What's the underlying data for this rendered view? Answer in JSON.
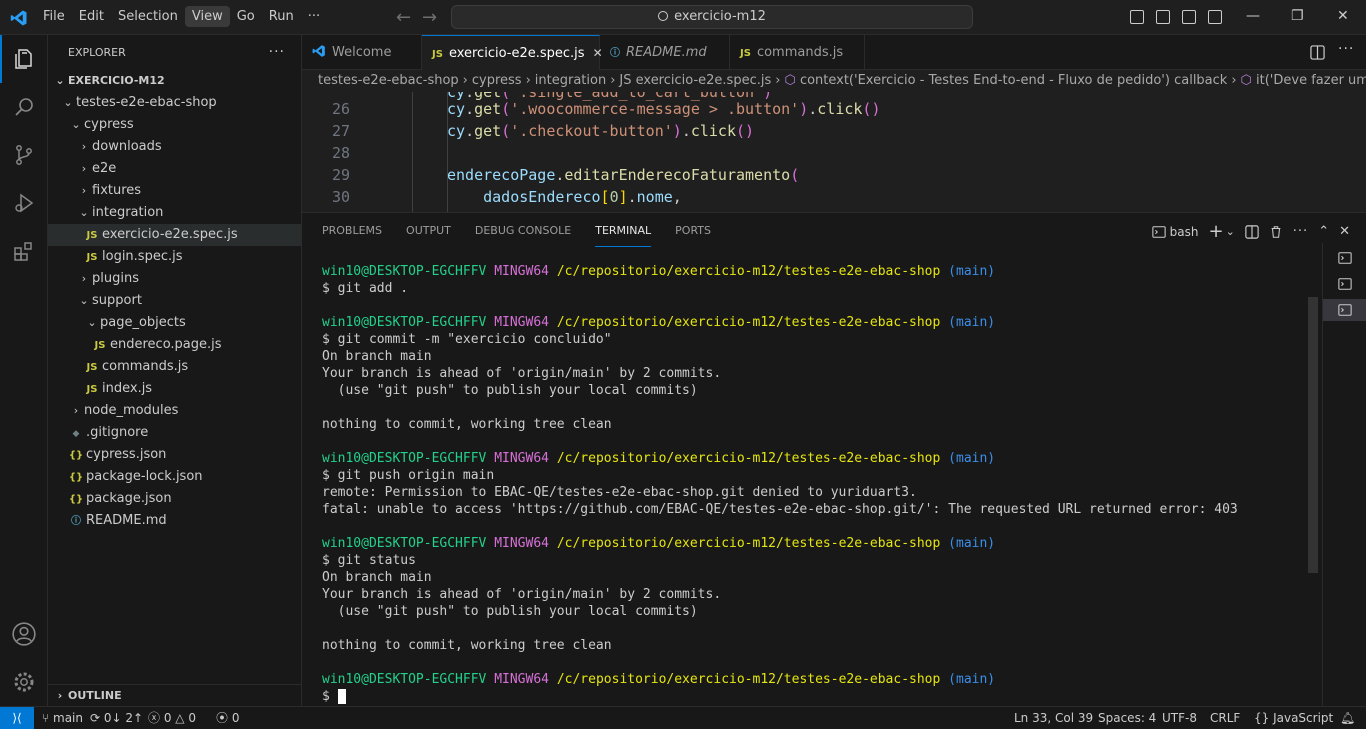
{
  "menu": [
    "File",
    "Edit",
    "Selection",
    "View",
    "Go",
    "Run",
    "···"
  ],
  "search": {
    "text": "exercicio-m12"
  },
  "window": {
    "minimize": "—",
    "restore": "❐",
    "close": "✕"
  },
  "explorer": {
    "title": "EXPLORER",
    "more": "···",
    "root": "EXERCICIO-M12",
    "items": [
      {
        "label": "testes-e2e-ebac-shop",
        "indent": 1,
        "kind": "folder-open"
      },
      {
        "label": "cypress",
        "indent": 2,
        "kind": "folder-open"
      },
      {
        "label": "downloads",
        "indent": 3,
        "kind": "folder"
      },
      {
        "label": "e2e",
        "indent": 3,
        "kind": "folder"
      },
      {
        "label": "fixtures",
        "indent": 3,
        "kind": "folder"
      },
      {
        "label": "integration",
        "indent": 3,
        "kind": "folder-open"
      },
      {
        "label": "exercicio-e2e.spec.js",
        "indent": 4,
        "kind": "js"
      },
      {
        "label": "login.spec.js",
        "indent": 4,
        "kind": "js"
      },
      {
        "label": "plugins",
        "indent": 3,
        "kind": "folder"
      },
      {
        "label": "support",
        "indent": 3,
        "kind": "folder-open"
      },
      {
        "label": "page_objects",
        "indent": 4,
        "kind": "folder-open"
      },
      {
        "label": "endereco.page.js",
        "indent": 5,
        "kind": "js"
      },
      {
        "label": "commands.js",
        "indent": 4,
        "kind": "js"
      },
      {
        "label": "index.js",
        "indent": 4,
        "kind": "js"
      },
      {
        "label": "node_modules",
        "indent": 2,
        "kind": "folder"
      },
      {
        "label": ".gitignore",
        "indent": 2,
        "kind": "git"
      },
      {
        "label": "cypress.json",
        "indent": 2,
        "kind": "json"
      },
      {
        "label": "package-lock.json",
        "indent": 2,
        "kind": "json"
      },
      {
        "label": "package.json",
        "indent": 2,
        "kind": "json"
      },
      {
        "label": "README.md",
        "indent": 2,
        "kind": "info"
      }
    ],
    "outline": "OUTLINE"
  },
  "tabs": [
    {
      "label": "Welcome",
      "icon": "vscode-icon",
      "active": false,
      "italic": false
    },
    {
      "label": "exercicio-e2e.spec.js",
      "icon": "JS",
      "active": true,
      "italic": false
    },
    {
      "label": "README.md",
      "icon": "ⓘ",
      "active": false,
      "italic": true
    },
    {
      "label": "commands.js",
      "icon": "JS",
      "active": false,
      "italic": false
    }
  ],
  "breadcrumb": [
    "testes-e2e-ebac-shop",
    "cypress",
    "integration",
    "JS exercicio-e2e.spec.js",
    "context('Exercicio - Testes End-to-end - Fluxo de pedido') callback",
    "it('Deve fazer um pedido na loja"
  ],
  "code": [
    {
      "ln": "26",
      "parts": [
        [
          "cy",
          "var"
        ],
        [
          ".",
          "txt"
        ],
        [
          "get",
          "fn"
        ],
        [
          "(",
          "p2"
        ],
        [
          "'.woocommerce-message > .button'",
          "str"
        ],
        [
          ")",
          "p2"
        ],
        [
          ".",
          "txt"
        ],
        [
          "click",
          "fn"
        ],
        [
          "()",
          "p2"
        ]
      ]
    },
    {
      "ln": "27",
      "parts": [
        [
          "cy",
          "var"
        ],
        [
          ".",
          "txt"
        ],
        [
          "get",
          "fn"
        ],
        [
          "(",
          "p2"
        ],
        [
          "'.checkout-button'",
          "str"
        ],
        [
          ")",
          "p2"
        ],
        [
          ".",
          "txt"
        ],
        [
          "click",
          "fn"
        ],
        [
          "()",
          "p2"
        ]
      ]
    },
    {
      "ln": "28",
      "parts": []
    },
    {
      "ln": "29",
      "parts": [
        [
          "enderecoPage",
          "var"
        ],
        [
          ".",
          "txt"
        ],
        [
          "editarEnderecoFaturamento",
          "fn"
        ],
        [
          "(",
          "p2"
        ]
      ]
    },
    {
      "ln": "30",
      "parts": [
        [
          "    dadosEndereco",
          "var"
        ],
        [
          "[",
          "p"
        ],
        [
          "0",
          "num"
        ],
        [
          "]",
          "p"
        ],
        [
          ".",
          "txt"
        ],
        [
          "nome",
          "var"
        ],
        [
          ",",
          "txt"
        ]
      ]
    }
  ],
  "panel": {
    "tabs": [
      "PROBLEMS",
      "OUTPUT",
      "DEBUG CONSOLE",
      "TERMINAL",
      "PORTS"
    ],
    "active_tab": "TERMINAL",
    "shell": "bash"
  },
  "terminal": {
    "user": "win10@DESKTOP-EGCHFFV",
    "host": "MINGW64",
    "path": "/c/repositorio/exercicio-m12/testes-e2e-ebac-shop",
    "branch": "(main)",
    "lines": [
      {
        "type": "prompt"
      },
      {
        "type": "text",
        "text": "$ git add ."
      },
      {
        "type": "blank"
      },
      {
        "type": "prompt"
      },
      {
        "type": "text",
        "text": "$ git commit -m \"exercicio concluido\""
      },
      {
        "type": "text",
        "text": "On branch main"
      },
      {
        "type": "text",
        "text": "Your branch is ahead of 'origin/main' by 2 commits."
      },
      {
        "type": "text",
        "text": "  (use \"git push\" to publish your local commits)"
      },
      {
        "type": "blank"
      },
      {
        "type": "text",
        "text": "nothing to commit, working tree clean"
      },
      {
        "type": "blank"
      },
      {
        "type": "prompt"
      },
      {
        "type": "text",
        "text": "$ git push origin main"
      },
      {
        "type": "text",
        "text": "remote: Permission to EBAC-QE/testes-e2e-ebac-shop.git denied to yuriduart3."
      },
      {
        "type": "text",
        "text": "fatal: unable to access 'https://github.com/EBAC-QE/testes-e2e-ebac-shop.git/': The requested URL returned error: 403"
      },
      {
        "type": "blank"
      },
      {
        "type": "prompt"
      },
      {
        "type": "text",
        "text": "$ git status"
      },
      {
        "type": "text",
        "text": "On branch main"
      },
      {
        "type": "text",
        "text": "Your branch is ahead of 'origin/main' by 2 commits."
      },
      {
        "type": "text",
        "text": "  (use \"git push\" to publish your local commits)"
      },
      {
        "type": "blank"
      },
      {
        "type": "text",
        "text": "nothing to commit, working tree clean"
      },
      {
        "type": "blank"
      },
      {
        "type": "prompt"
      },
      {
        "type": "cursor",
        "text": "$ "
      }
    ]
  },
  "status": {
    "branch": "main",
    "sync": "0↓ 2↑",
    "errors": "0",
    "warnings": "0",
    "ports": "0",
    "position": "Ln 33, Col 39",
    "spaces": "Spaces: 4",
    "encoding": "UTF-8",
    "eol": "CRLF",
    "language": "{} JavaScript"
  },
  "colors": {
    "accent": "#0078d4",
    "js": "#cbcb41",
    "term_user": "#23d18b",
    "term_host": "#d670d6",
    "term_path": "#e5e510",
    "term_branch": "#3b8eea"
  }
}
